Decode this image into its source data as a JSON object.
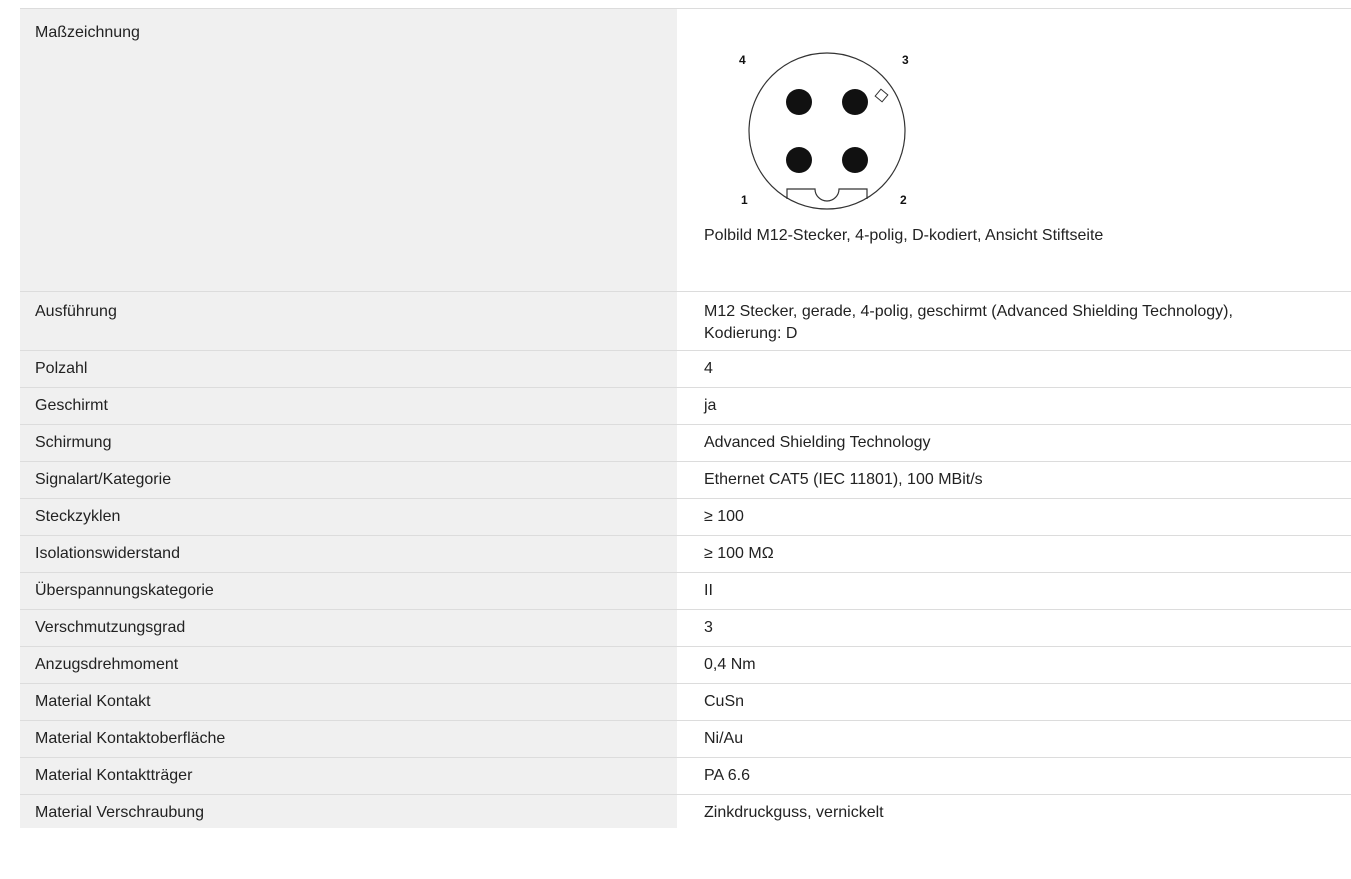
{
  "drawing": {
    "label": "Maßzeichnung",
    "caption": "Polbild M12-Stecker, 4-polig, D-kodiert, Ansicht Stiftseite",
    "pin_numbers": [
      "4",
      "3",
      "1",
      "2"
    ]
  },
  "rows": [
    {
      "label": "Ausführung",
      "value": "M12 Stecker, gerade, 4-polig, geschirmt (Advanced Shielding Technology), Kodierung: D"
    },
    {
      "label": "Polzahl",
      "value": "4"
    },
    {
      "label": "Geschirmt",
      "value": "ja"
    },
    {
      "label": "Schirmung",
      "value": "Advanced Shielding Technology"
    },
    {
      "label": "Signalart/Kategorie",
      "value": "Ethernet CAT5 (IEC 11801), 100 MBit/s"
    },
    {
      "label": "Steckzyklen",
      "value": "≥ 100"
    },
    {
      "label": "Isolationswiderstand",
      "value": "≥ 100 MΩ"
    },
    {
      "label": "Überspannungskategorie",
      "value": "II"
    },
    {
      "label": "Verschmutzungsgrad",
      "value": "3"
    },
    {
      "label": "Anzugsdrehmoment",
      "value": "0,4 Nm"
    },
    {
      "label": "Material Kontakt",
      "value": "CuSn"
    },
    {
      "label": "Material Kontaktoberfläche",
      "value": "Ni/Au"
    },
    {
      "label": "Material Kontaktträger",
      "value": "PA 6.6"
    },
    {
      "label": "Material Verschraubung",
      "value": "Zinkdruckguss, vernickelt"
    }
  ]
}
